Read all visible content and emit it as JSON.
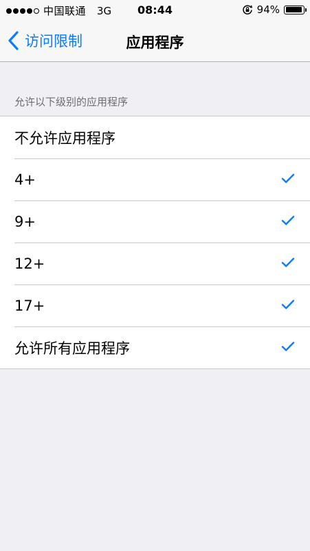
{
  "status_bar": {
    "carrier": "中国联通",
    "network": "3G",
    "time": "08:44",
    "battery_percent": "94%",
    "battery_level": 0.94,
    "signal_bars_filled": 4,
    "signal_bars_total": 5
  },
  "nav": {
    "back_label": "访问限制",
    "title": "应用程序"
  },
  "section": {
    "header": "允许以下级别的应用程序"
  },
  "rows": [
    {
      "label": "不允许应用程序",
      "checked": false
    },
    {
      "label": "4+",
      "checked": true
    },
    {
      "label": "9+",
      "checked": true
    },
    {
      "label": "12+",
      "checked": true
    },
    {
      "label": "17+",
      "checked": true
    },
    {
      "label": "允许所有应用程序",
      "checked": true
    }
  ],
  "colors": {
    "accent": "#0a7aff",
    "background": "#efeff4",
    "separator": "#c8c7cc",
    "section_header_text": "#6d6d72"
  },
  "icons": {
    "back": "chevron-left-icon",
    "check": "checkmark-icon",
    "orientation_lock": "orientation-lock-icon",
    "battery": "battery-icon"
  }
}
